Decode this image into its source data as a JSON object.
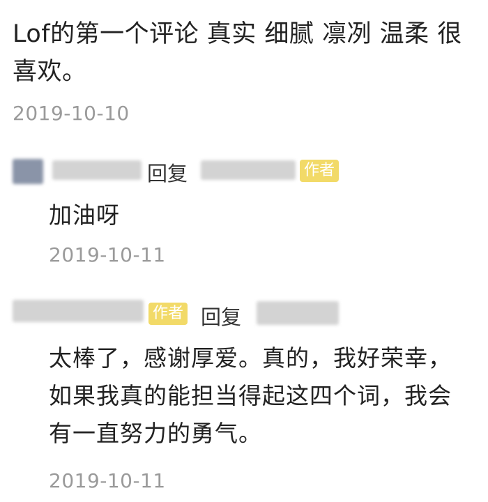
{
  "main_comment": {
    "text": "Lof的第一个评论 真实 细腻 凛冽 温柔 很喜欢。",
    "date": "2019-10-10"
  },
  "reply_1": {
    "reply_label": "回复",
    "author_badge": "作者",
    "text": "加油呀",
    "date": "2019-10-11"
  },
  "reply_2": {
    "author_badge": "作者",
    "reply_label": "回复",
    "text": "太棒了，感谢厚爱。真的，我好荣幸，如果我真的能担当得起这四个词，我会有一直努力的勇气。",
    "date": "2019-10-11"
  },
  "colors": {
    "text": "#222222",
    "date": "#9a9a9a",
    "author_badge_bg": "#f2da68",
    "blur_gray": "#d3d3d3"
  }
}
